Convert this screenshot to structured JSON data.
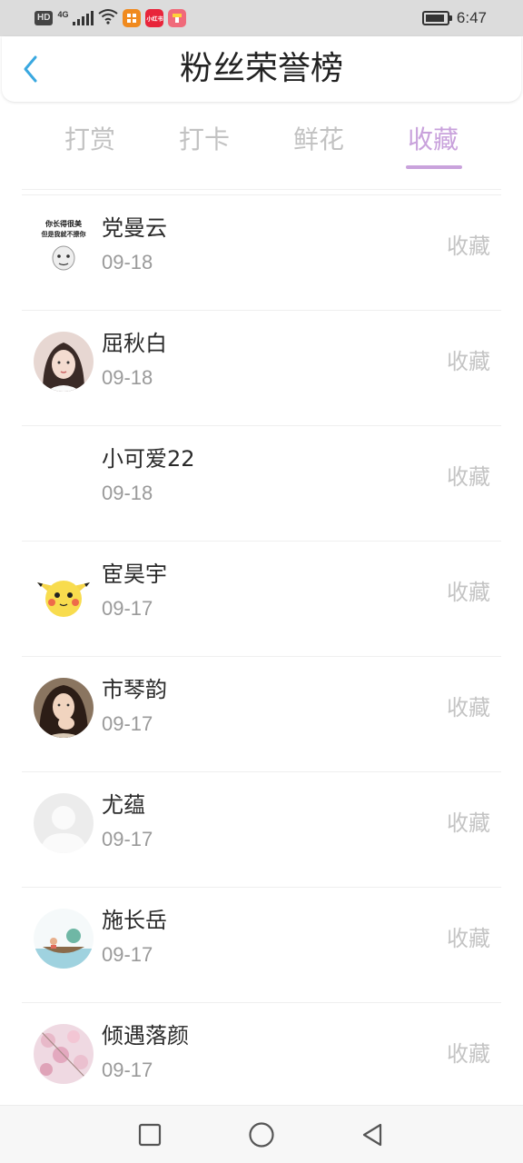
{
  "status_bar": {
    "hd": "HD",
    "network": "4G",
    "time": "6:47",
    "icons": [
      "signal-icon",
      "wifi-icon",
      "app-icon-orange",
      "app-icon-red",
      "app-icon-pink",
      "battery-icon"
    ],
    "app2_text": "小红书"
  },
  "header": {
    "title": "粉丝荣誉榜",
    "back_icon": "chevron-left-icon",
    "accent_color": "#3aa8e0"
  },
  "tabs": [
    {
      "label": "打赏",
      "active": false
    },
    {
      "label": "打卡",
      "active": false
    },
    {
      "label": "鲜花",
      "active": false
    },
    {
      "label": "收藏",
      "active": true
    }
  ],
  "tab_active_color": "#c9a2dc",
  "list": [
    {
      "name": "党曼云",
      "date": "09-18",
      "action": "收藏",
      "avatar": "meme-avatar",
      "avatar_text_1": "你长得很美",
      "avatar_text_2": "但是我就不撩你"
    },
    {
      "name": "屈秋白",
      "date": "09-18",
      "action": "收藏",
      "avatar": "photo-avatar-girl"
    },
    {
      "name": "小可爱22",
      "date": "09-18",
      "action": "收藏",
      "avatar": "blank-avatar"
    },
    {
      "name": "宦昊宇",
      "date": "09-17",
      "action": "收藏",
      "avatar": "pikachu-avatar"
    },
    {
      "name": "市琴韵",
      "date": "09-17",
      "action": "收藏",
      "avatar": "photo-avatar-woman"
    },
    {
      "name": "尤蕴",
      "date": "09-17",
      "action": "收藏",
      "avatar": "default-user-avatar"
    },
    {
      "name": "施长岳",
      "date": "09-17",
      "action": "收藏",
      "avatar": "boat-illustration-avatar"
    },
    {
      "name": "倾遇落颜",
      "date": "09-17",
      "action": "收藏",
      "avatar": "blossom-avatar"
    }
  ],
  "nav_bar": {
    "buttons": [
      "recent-apps-icon",
      "home-icon",
      "back-icon"
    ]
  }
}
